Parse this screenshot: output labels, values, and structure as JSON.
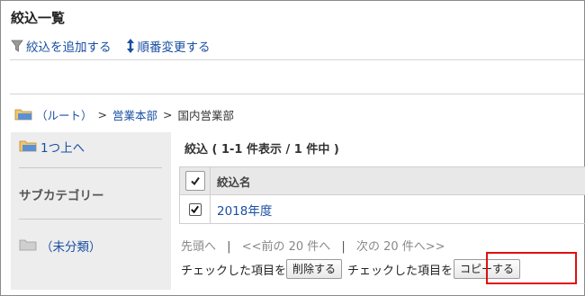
{
  "page_title": "絞込一覧",
  "toolbar": {
    "add_filter": "絞込を追加する",
    "reorder": "順番変更する"
  },
  "breadcrumb": {
    "root": "（ルート）",
    "sep": ">",
    "level1": "営業本部",
    "current": "国内営業部"
  },
  "sidebar": {
    "up_one": "1つ上へ",
    "subcategory_heading": "サブカテゴリー",
    "uncategorized": "（未分類）"
  },
  "summary": "絞込 ( 1-1 件表示 / 1 件中 )",
  "table": {
    "header": "絞込名",
    "rows": [
      {
        "name": "2018年度",
        "checked": true
      }
    ]
  },
  "pager": {
    "first": "先頭へ",
    "prev": "<<前の 20 件へ",
    "next": "次の 20 件へ>>",
    "sep": "|"
  },
  "actions": {
    "prefix1": "チェックした項目を",
    "delete_button": "削除する",
    "prefix2": "チェックした項目を",
    "copy_button": "コピーする"
  },
  "colors": {
    "link": "#1a4fa3",
    "highlight": "#e01010"
  }
}
